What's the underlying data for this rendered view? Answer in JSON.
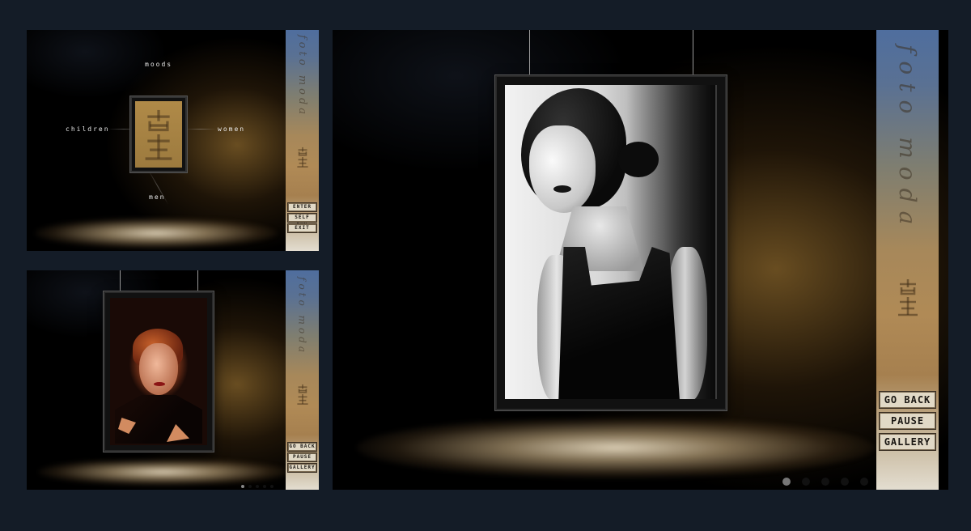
{
  "theme": {
    "page_bg": "#141c27",
    "accent_gold": "#b08a56",
    "accent_blue": "#4f6e9e"
  },
  "brand": {
    "vertical_text": "foto moda",
    "logo_icon": "foto-moda-glyph-icon"
  },
  "screens": {
    "menu": {
      "nav": {
        "moods": "moods",
        "children": "children",
        "women": "women",
        "men": "men"
      },
      "sidebar_buttons": [
        "ENTER",
        "SELF RUN",
        "EXIT"
      ]
    },
    "small_gallery": {
      "sidebar_buttons": [
        "GO BACK",
        "PAUSE",
        "GALLERY"
      ],
      "photo_icon": "woman-portrait-photo",
      "page_dots": 5,
      "active_dot": 0
    },
    "large_gallery": {
      "sidebar_buttons": [
        "GO BACK",
        "PAUSE",
        "GALLERY"
      ],
      "photo_icon": "woman-black-dress-photo",
      "page_dots": 5,
      "active_dot": 0
    }
  }
}
